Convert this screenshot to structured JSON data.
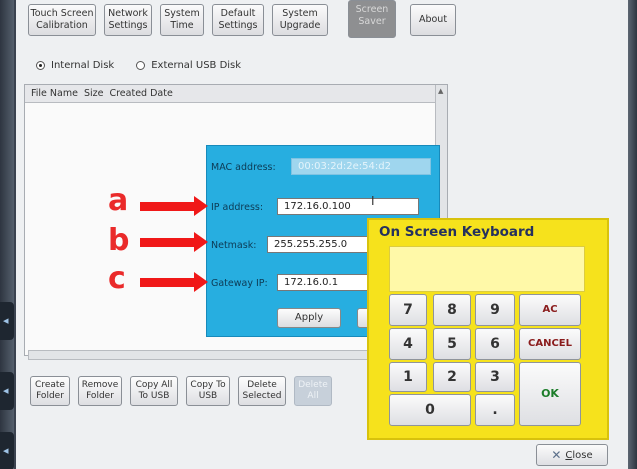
{
  "tabs": [
    {
      "label": "Touch Screen\nCalibration",
      "active": false
    },
    {
      "label": "Network\nSettings",
      "active": false
    },
    {
      "label": "System\nTime",
      "active": false
    },
    {
      "label": "Default\nSettings",
      "active": false
    },
    {
      "label": "System\nUpgrade",
      "active": false
    },
    {
      "label": "Screen\nSaver",
      "active": true
    },
    {
      "label": "About",
      "active": false
    }
  ],
  "storage": {
    "internal_label": "Internal Disk",
    "external_label": "External USB Disk",
    "selected": "Internal Disk"
  },
  "file_table": {
    "columns": [
      "File Name",
      "Size",
      "Created Date"
    ]
  },
  "network": {
    "mac_label": "MAC address:",
    "mac_value": "00:03:2d:2e:54:d2",
    "ip_label": "IP address:",
    "ip_value": "172.16.0.100",
    "netmask_label": "Netmask:",
    "netmask_value": "255.255.255.0",
    "gateway_label": "Gateway IP:",
    "gateway_value": "172.16.0.1",
    "apply_label": "Apply"
  },
  "annotations": [
    "a",
    "b",
    "c"
  ],
  "file_actions": [
    {
      "label": "Create\nFolder",
      "enabled": true
    },
    {
      "label": "Remove\nFolder",
      "enabled": true
    },
    {
      "label": "Copy All\nTo USB",
      "enabled": true
    },
    {
      "label": "Copy To\nUSB",
      "enabled": true
    },
    {
      "label": "Delete\nSelected",
      "enabled": true
    },
    {
      "label": "Delete\nAll",
      "enabled": false
    }
  ],
  "keyboard": {
    "title": "On Screen Keyboard",
    "keys": {
      "k7": "7",
      "k8": "8",
      "k9": "9",
      "ac": "AC",
      "k4": "4",
      "k5": "5",
      "k6": "6",
      "cancel": "CANCEL",
      "k1": "1",
      "k2": "2",
      "k3": "3",
      "ok": "OK",
      "k0": "0",
      "dot": "."
    }
  },
  "close_label": "Close",
  "close_access_key": "C",
  "close_rest": "lose",
  "colors": {
    "dialog": "#27aee0",
    "keyboard": "#f6e21c",
    "annotation": "#f01818"
  }
}
